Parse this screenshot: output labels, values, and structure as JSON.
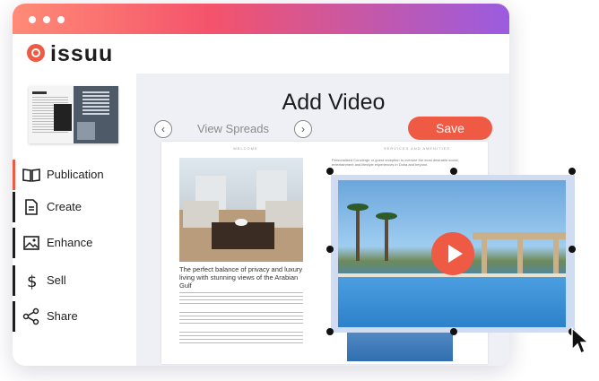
{
  "app": {
    "logo_text": "issuu"
  },
  "sidebar": {
    "items": [
      {
        "label": "Publication",
        "icon": "book-icon"
      },
      {
        "label": "Create",
        "icon": "document-icon"
      },
      {
        "label": "Enhance",
        "icon": "image-icon"
      },
      {
        "label": "Sell",
        "icon": "dollar-icon"
      },
      {
        "label": "Share",
        "icon": "share-icon"
      }
    ]
  },
  "main": {
    "title": "Add Video",
    "view_spreads_label": "View Spreads",
    "save_label": "Save",
    "prev_label": "‹",
    "next_label": "›"
  },
  "spread": {
    "left_header": "WELCOME",
    "right_header": "SERVICES AND AMENITIES",
    "left_heading": "The perfect balance of privacy and luxury living with stunning views of the Arabian Gulf",
    "right_body": "Personalised Concierge or guest reception to oversee the most desirable social, entertainment and lifestyle experiences in Doha and beyond"
  },
  "colors": {
    "accent": "#ee5a44",
    "selection": "#cfdcf2"
  }
}
